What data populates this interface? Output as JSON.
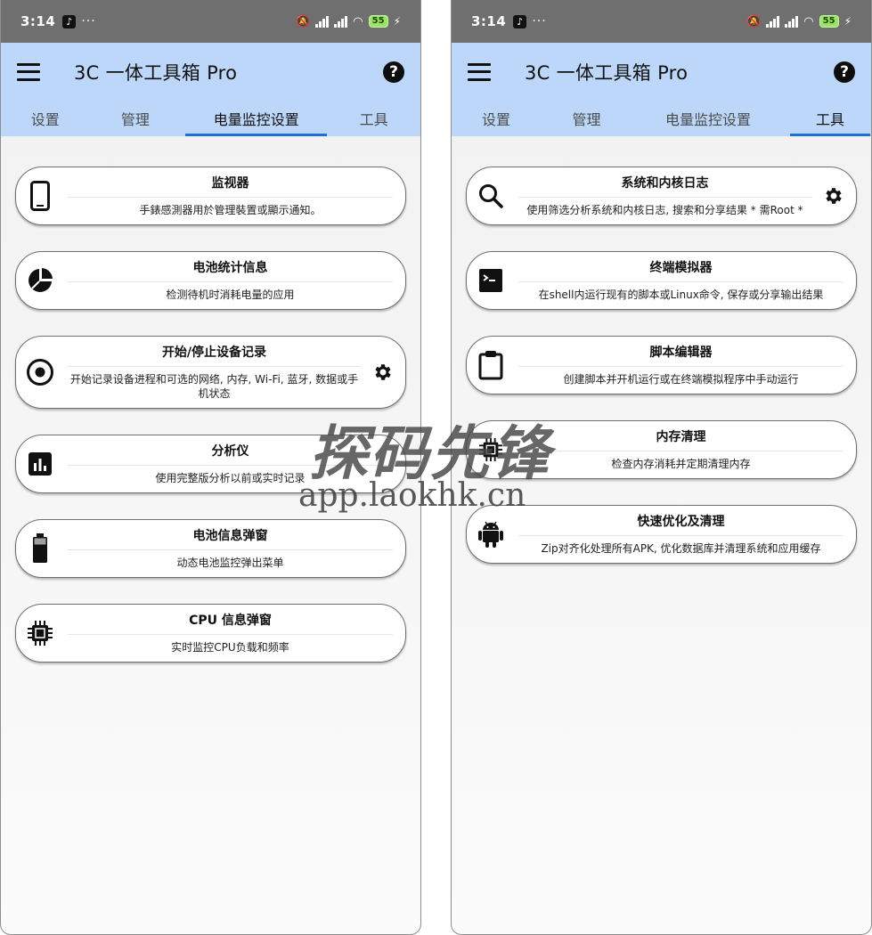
{
  "status_bar": {
    "time": "3:14",
    "app_glyph": "♪",
    "more": "···",
    "battery": "55",
    "charge": "⚡"
  },
  "app_bar": {
    "title": "3C 一体工具箱 Pro"
  },
  "left_screen": {
    "tabs": [
      {
        "label": "设置"
      },
      {
        "label": "管理"
      },
      {
        "label": "电量监控设置"
      },
      {
        "label": "工具"
      }
    ],
    "cards": [
      {
        "title": "监视器",
        "desc": "手錶感測器用於管理裝置或顯示通知。",
        "icon": "phone-icon"
      },
      {
        "title": "电池统计信息",
        "desc": "检测待机时消耗电量的应用",
        "icon": "pie-chart-icon"
      },
      {
        "title": "开始/停止设备记录",
        "desc": "开始记录设备进程和可选的网络, 内存, Wi-Fi, 蓝牙, 数据或手机状态",
        "icon": "record-icon",
        "gear": true
      },
      {
        "title": "分析仪",
        "desc": "使用完整版分析以前或实时记录",
        "icon": "bar-chart-icon"
      },
      {
        "title": "电池信息弹窗",
        "desc": "动态电池监控弹出菜单",
        "icon": "battery-icon"
      },
      {
        "title": "CPU 信息弹窗",
        "desc": "实时监控CPU负载和频率",
        "icon": "cpu-icon"
      }
    ]
  },
  "right_screen": {
    "tabs": [
      {
        "label": "设置"
      },
      {
        "label": "管理"
      },
      {
        "label": "电量监控设置"
      },
      {
        "label": "工具"
      }
    ],
    "cards": [
      {
        "title": "系统和内核日志",
        "desc": "使用筛选分析系统和内核日志, 搜索和分享结果 * 需Root *",
        "icon": "search-icon",
        "gear": true
      },
      {
        "title": "终端模拟器",
        "desc": "在shell内运行现有的脚本或Linux命令, 保存或分享输出结果",
        "icon": "terminal-icon"
      },
      {
        "title": "脚本编辑器",
        "desc": "创建脚本并开机运行或在终端模拟程序中手动运行",
        "icon": "clipboard-icon"
      },
      {
        "title": "内存清理",
        "desc": "检查内存消耗并定期清理内存",
        "icon": "memory-chip-icon"
      },
      {
        "title": "快速优化及清理",
        "desc": "Zip对齐化处理所有APK, 优化数据库并清理系统和应用缓存",
        "icon": "android-icon"
      }
    ]
  },
  "watermark": {
    "brand": "探码先锋",
    "url": "app.laokhk.cn"
  },
  "colors": {
    "app_bar": "#bcd7f9",
    "tab_indicator": "#1e6fd9",
    "status_bar": "#6f6f6f"
  }
}
